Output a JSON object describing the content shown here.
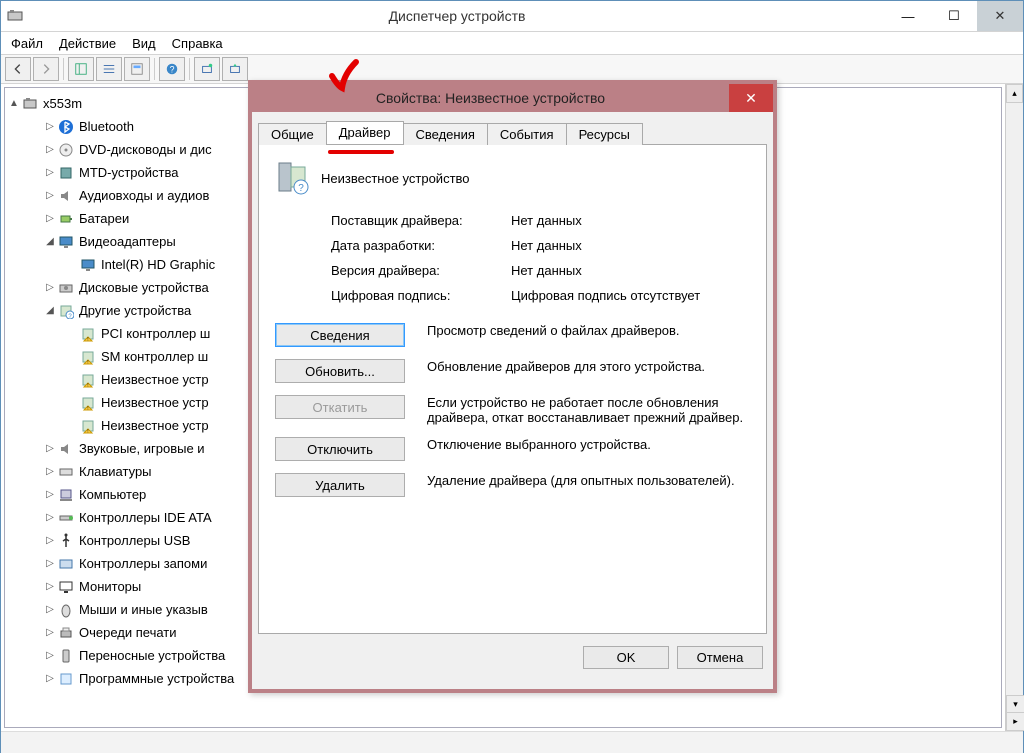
{
  "window": {
    "title": "Диспетчер устройств",
    "menu": [
      "Файл",
      "Действие",
      "Вид",
      "Справка"
    ]
  },
  "tree": {
    "root": "x553m",
    "items": [
      {
        "indent": 1,
        "arrow": "▷",
        "icon": "bluetooth",
        "label": "Bluetooth"
      },
      {
        "indent": 1,
        "arrow": "▷",
        "icon": "disc",
        "label": "DVD-дисководы и дис"
      },
      {
        "indent": 1,
        "arrow": "▷",
        "icon": "chip",
        "label": "MTD-устройства"
      },
      {
        "indent": 1,
        "arrow": "▷",
        "icon": "audio",
        "label": "Аудиовходы и аудиов"
      },
      {
        "indent": 1,
        "arrow": "▷",
        "icon": "battery",
        "label": "Батареи"
      },
      {
        "indent": 1,
        "arrow": "▲",
        "icon": "display",
        "label": "Видеоадаптеры"
      },
      {
        "indent": 2,
        "arrow": "",
        "icon": "display",
        "label": "Intel(R) HD Graphic"
      },
      {
        "indent": 1,
        "arrow": "▷",
        "icon": "drive",
        "label": "Дисковые устройства"
      },
      {
        "indent": 1,
        "arrow": "▲",
        "icon": "unknown",
        "label": "Другие устройства"
      },
      {
        "indent": 2,
        "arrow": "",
        "icon": "warn",
        "label": "PCI контроллер ш"
      },
      {
        "indent": 2,
        "arrow": "",
        "icon": "warn",
        "label": "SM контроллер ш"
      },
      {
        "indent": 2,
        "arrow": "",
        "icon": "warn",
        "label": "Неизвестное устр"
      },
      {
        "indent": 2,
        "arrow": "",
        "icon": "warn",
        "label": "Неизвестное устр"
      },
      {
        "indent": 2,
        "arrow": "",
        "icon": "warn",
        "label": "Неизвестное устр"
      },
      {
        "indent": 1,
        "arrow": "▷",
        "icon": "audio",
        "label": "Звуковые, игровые и"
      },
      {
        "indent": 1,
        "arrow": "▷",
        "icon": "keyboard",
        "label": "Клавиатуры"
      },
      {
        "indent": 1,
        "arrow": "▷",
        "icon": "computer",
        "label": "Компьютер"
      },
      {
        "indent": 1,
        "arrow": "▷",
        "icon": "ide",
        "label": "Контроллеры IDE ATA"
      },
      {
        "indent": 1,
        "arrow": "▷",
        "icon": "usb",
        "label": "Контроллеры USB"
      },
      {
        "indent": 1,
        "arrow": "▷",
        "icon": "storage",
        "label": "Контроллеры запоми"
      },
      {
        "indent": 1,
        "arrow": "▷",
        "icon": "monitor",
        "label": "Мониторы"
      },
      {
        "indent": 1,
        "arrow": "▷",
        "icon": "mouse",
        "label": "Мыши и иные указыв"
      },
      {
        "indent": 1,
        "arrow": "▷",
        "icon": "printer",
        "label": "Очереди печати"
      },
      {
        "indent": 1,
        "arrow": "▷",
        "icon": "portable",
        "label": "Переносные устройства"
      },
      {
        "indent": 1,
        "arrow": "▷",
        "icon": "software",
        "label": "Программные устройства"
      }
    ]
  },
  "dialog": {
    "title": "Свойства: Неизвестное устройство",
    "tabs": [
      "Общие",
      "Драйвер",
      "Сведения",
      "События",
      "Ресурсы"
    ],
    "active_tab": 1,
    "device_name": "Неизвестное устройство",
    "info": [
      {
        "label": "Поставщик драйвера:",
        "value": "Нет данных"
      },
      {
        "label": "Дата разработки:",
        "value": "Нет данных"
      },
      {
        "label": "Версия драйвера:",
        "value": "Нет данных"
      },
      {
        "label": "Цифровая подпись:",
        "value": "Цифровая подпись отсутствует"
      }
    ],
    "actions": [
      {
        "btn": "Сведения",
        "desc": "Просмотр сведений о файлах драйверов.",
        "focus": true,
        "enabled": true
      },
      {
        "btn": "Обновить...",
        "desc": "Обновление драйверов для этого устройства.",
        "enabled": true
      },
      {
        "btn": "Откатить",
        "desc": "Если устройство не работает после обновления драйвера, откат восстанавливает прежний драйвер.",
        "enabled": false
      },
      {
        "btn": "Отключить",
        "desc": "Отключение выбранного устройства.",
        "enabled": true
      },
      {
        "btn": "Удалить",
        "desc": "Удаление драйвера (для опытных пользователей).",
        "enabled": true
      }
    ],
    "ok": "OK",
    "cancel": "Отмена"
  }
}
